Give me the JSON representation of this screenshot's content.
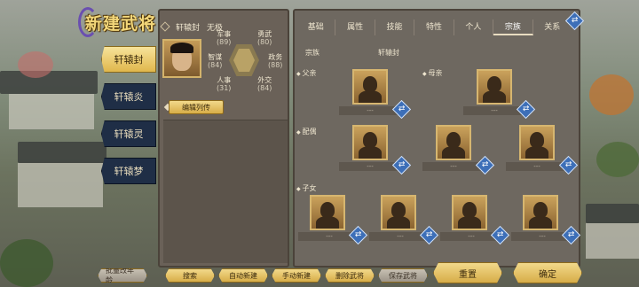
{
  "title": "新建武将",
  "characters": [
    {
      "label": "轩辕封",
      "active": true
    },
    {
      "label": "轩辕炎",
      "active": false
    },
    {
      "label": "轩辕灵",
      "active": false
    },
    {
      "label": "轩辕梦",
      "active": false
    }
  ],
  "profile": {
    "name": "轩辕封",
    "status": "无极",
    "bio_button": "编辑列传"
  },
  "stats": {
    "military": {
      "label": "军事",
      "value": "(89)"
    },
    "bravery": {
      "label": "勇武",
      "value": "(80)"
    },
    "intellect": {
      "label": "智谋",
      "value": "(84)"
    },
    "politics": {
      "label": "政务",
      "value": "(88)"
    },
    "personnel": {
      "label": "人事",
      "value": "(31)"
    },
    "diplomacy": {
      "label": "外交",
      "value": "(84)"
    }
  },
  "tabs": [
    {
      "label": "基础",
      "active": false
    },
    {
      "label": "属性",
      "active": false
    },
    {
      "label": "技能",
      "active": false
    },
    {
      "label": "特性",
      "active": false
    },
    {
      "label": "个人",
      "active": false
    },
    {
      "label": "宗族",
      "active": true
    },
    {
      "label": "关系",
      "active": false
    }
  ],
  "clan": {
    "label": "宗族",
    "value": "轩辕封"
  },
  "sections": {
    "father": "父亲",
    "mother": "母亲",
    "spouse": "配偶",
    "children": "子女"
  },
  "empty_slot_text": "---",
  "bottom_buttons": {
    "batch_age": "批量改年龄",
    "search": "搜索",
    "auto_create": "自动新建",
    "manual_create": "手动新建",
    "delete": "删除武将",
    "save": "保存武将",
    "reset": "重置",
    "confirm": "确定"
  },
  "colors": {
    "accent_gold": "#e0b74c",
    "nav_dark": "#1f2e46",
    "swap_blue": "#3d6fb8"
  },
  "icons": {
    "swap": "swap-arrows-icon"
  }
}
